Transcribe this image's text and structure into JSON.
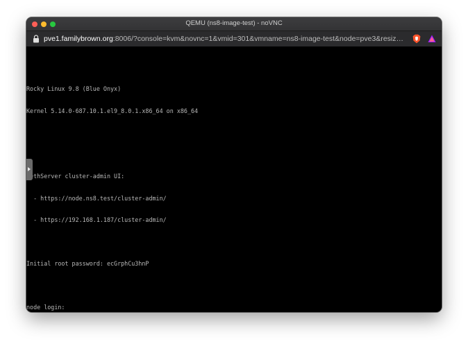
{
  "window": {
    "title": "QEMU (ns8-image-test) - noVNC"
  },
  "browser": {
    "url_host": "pve1.familybrown.org",
    "url_rest": ":8006/?console=kvm&novnc=1&vmid=301&vmname=ns8-image-test&node=pve3&resize=of...",
    "icons": [
      "lock-icon",
      "brave-shields-icon",
      "brave-rewards-icon"
    ]
  },
  "console": {
    "lines": [
      "Rocky Linux 9.8 (Blue Onyx)",
      "Kernel 5.14.0-687.10.1.el9_8.0.1.x86_64 on x86_64",
      "",
      "",
      "NethServer cluster-admin UI:",
      "  - https://node.ns8.test/cluster-admin/",
      "  - https://192.168.1.187/cluster-admin/",
      "",
      "Initial root password: ecGrphCu3hnP",
      "",
      "node login:"
    ]
  },
  "colors": {
    "console_bg": "#000000",
    "console_text": "#b9b9b9",
    "titlebar": "#383838",
    "close": "#fe5f57",
    "minimize": "#febc2e",
    "zoom": "#28c840"
  }
}
